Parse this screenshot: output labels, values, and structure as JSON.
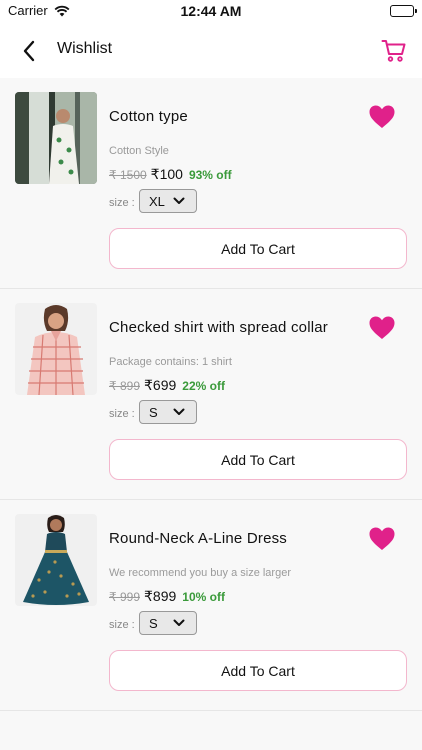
{
  "status_bar": {
    "carrier": "Carrier",
    "time": "12:44 AM"
  },
  "nav": {
    "title": "Wishlist",
    "back_icon": "chevron-left-icon",
    "cart_icon": "shopping-cart-icon"
  },
  "colors": {
    "accent": "#e0218a",
    "discount": "#3a9a3a",
    "button_border": "#f3b7cd"
  },
  "items": [
    {
      "name": "Cotton type",
      "description": "Cotton Style",
      "old_price": "₹ 1500",
      "price": "₹100",
      "discount": "93% off",
      "size_label": "size :",
      "size": "XL",
      "button": "Add To Cart"
    },
    {
      "name": "Checked shirt with spread collar",
      "description": "Package contains: 1 shirt",
      "old_price": "₹ 899",
      "price": "₹699",
      "discount": "22% off",
      "size_label": "size :",
      "size": "S",
      "button": "Add To Cart"
    },
    {
      "name": "Round-Neck A-Line Dress",
      "description": "We recommend you buy a size larger",
      "old_price": "₹ 999",
      "price": "₹899",
      "discount": "10% off",
      "size_label": "size :",
      "size": "S",
      "button": "Add To Cart"
    }
  ]
}
